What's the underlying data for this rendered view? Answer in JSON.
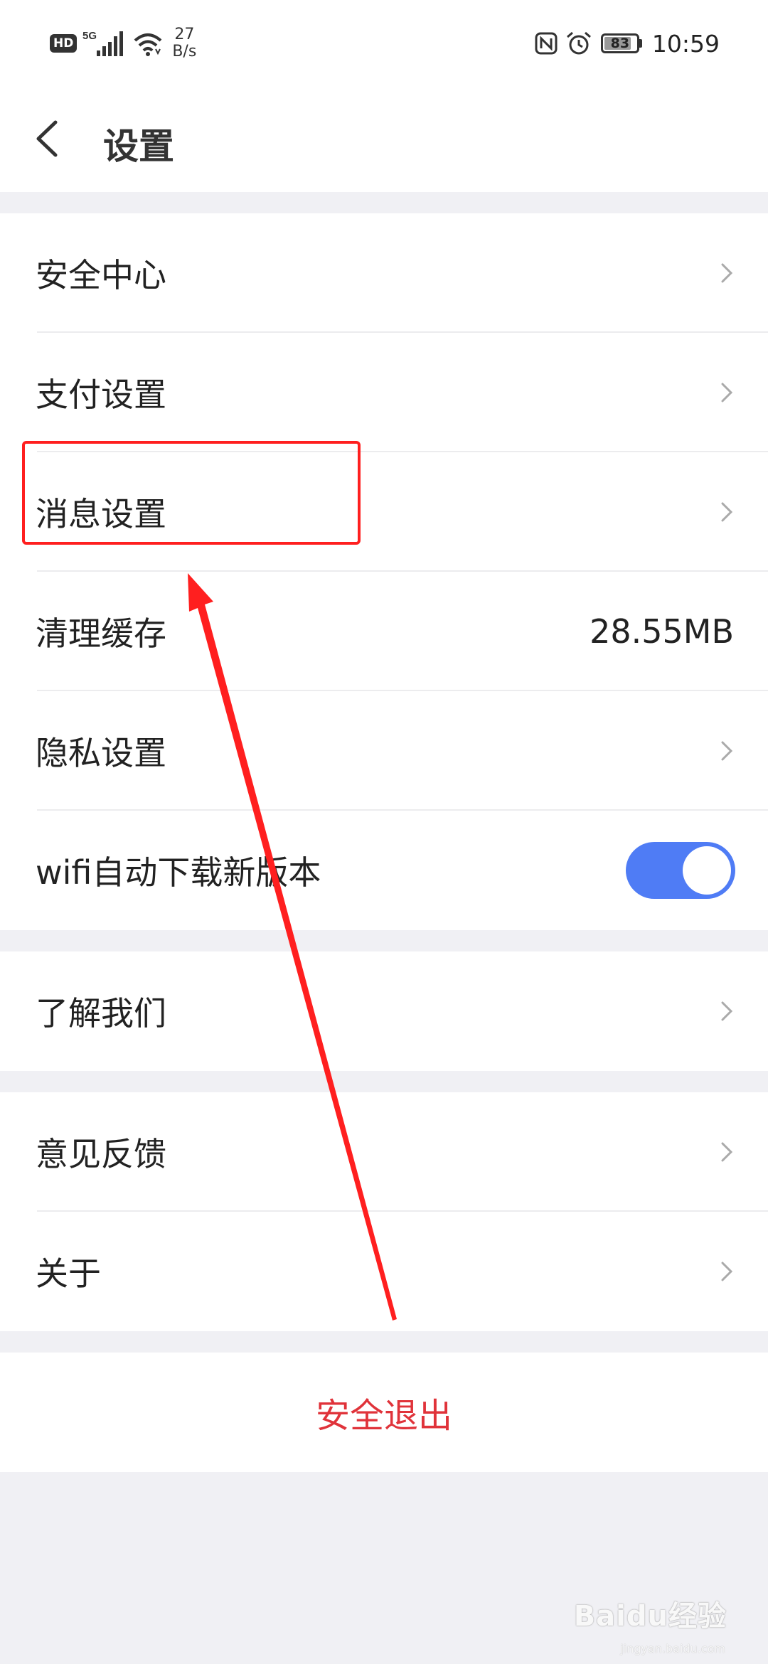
{
  "status_bar": {
    "hd_badge": "HD",
    "network": "5G",
    "speed_value": "27",
    "speed_unit": "B/s",
    "battery": "83",
    "battery_level": 0.83,
    "time": "10:59",
    "icons": [
      "signal-icon",
      "wifi-icon",
      "nfc-icon",
      "alarm-icon",
      "battery-icon"
    ]
  },
  "header": {
    "title": "设置",
    "back_icon": "chevron-left-icon"
  },
  "groups": [
    {
      "items": [
        {
          "label": "安全中心",
          "trailing": "chevron"
        },
        {
          "label": "支付设置",
          "trailing": "chevron"
        },
        {
          "label": "消息设置",
          "trailing": "chevron"
        },
        {
          "label": "清理缓存",
          "trailing": "value",
          "value": "28.55MB"
        },
        {
          "label": "隐私设置",
          "trailing": "chevron"
        },
        {
          "label": "wifi自动下载新版本",
          "trailing": "toggle",
          "toggle_on": true
        }
      ]
    },
    {
      "items": [
        {
          "label": "了解我们",
          "trailing": "chevron"
        }
      ]
    },
    {
      "items": [
        {
          "label": "意见反馈",
          "trailing": "chevron"
        },
        {
          "label": "关于",
          "trailing": "chevron"
        }
      ]
    }
  ],
  "logout": {
    "label": "安全退出"
  },
  "annotation": {
    "box_color": "#ff1f1f",
    "arrow_color": "#ff1f1f",
    "target": "消息设置"
  },
  "watermark": {
    "text": "Baidu经验",
    "sub": "jingyan.baidu.com"
  },
  "colors": {
    "accent": "#4f7cf5",
    "danger": "#e0333a",
    "background": "#f0f0f4"
  }
}
